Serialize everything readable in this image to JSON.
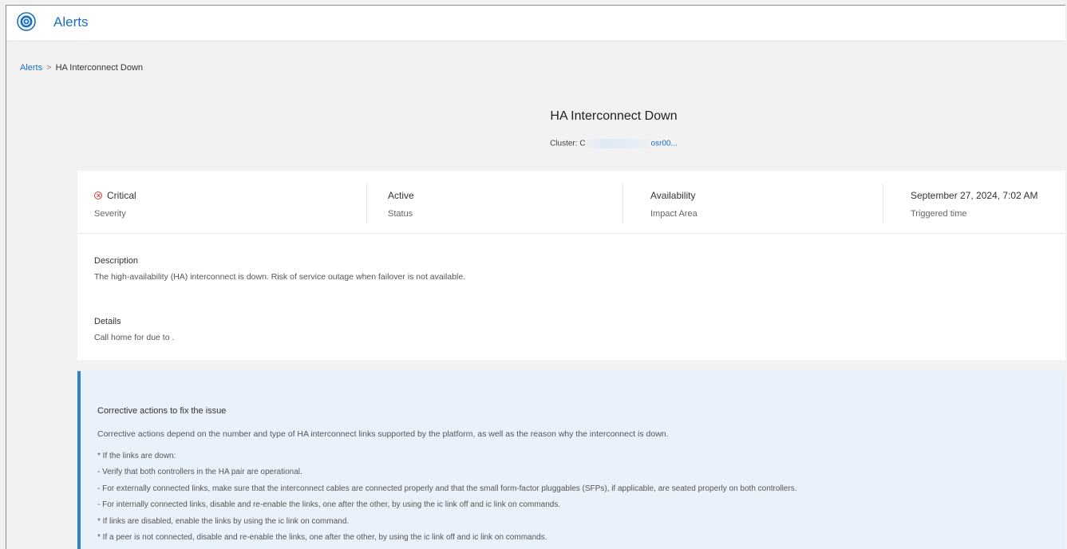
{
  "app": {
    "title": "Alerts",
    "icon": "alert-bell-icon"
  },
  "breadcrumb": {
    "root": "Alerts",
    "separator": ">",
    "current": "HA Interconnect Down"
  },
  "alert": {
    "title": "HA Interconnect Down",
    "cluster_label": "Cluster:",
    "cluster_prefix": "C",
    "cluster_suffix": "osr00..."
  },
  "summary": [
    {
      "value": "Critical",
      "label": "Severity",
      "icon": "critical-x-circle-icon"
    },
    {
      "value": "Active",
      "label": "Status"
    },
    {
      "value": "Availability",
      "label": "Impact Area"
    },
    {
      "value": "September 27, 2024, 7:02 AM",
      "label": "Triggered time"
    }
  ],
  "description": {
    "heading": "Description",
    "text": "The high-availability (HA) interconnect is down. Risk of service outage when failover is not available."
  },
  "details": {
    "heading": "Details",
    "text": "Call home for due to ."
  },
  "corrective": {
    "heading": "Corrective actions to fix the issue",
    "intro": "Corrective actions depend on the number and type of HA interconnect links supported by the platform, as well as the reason why the interconnect is down.",
    "lines": [
      "* If the links are down:",
      "- Verify that both controllers in the HA pair are operational.",
      "- For externally connected links, make sure that the interconnect cables are connected properly and that the small form-factor pluggables (SFPs), if applicable, are seated properly on both controllers.",
      "- For internally connected links, disable and re-enable the links, one after the other, by using the ic link off and ic link on commands.",
      "* If links are disabled, enable the links by using the ic link on command.",
      "* If a peer is not connected, disable and re-enable the links, one after the other, by using the ic link off and ic link on commands."
    ]
  },
  "colors": {
    "accent": "#1b6fc0",
    "critical": "#d63b3b",
    "panel_bg": "#e9f2fb",
    "panel_border": "#2f7fd6"
  }
}
